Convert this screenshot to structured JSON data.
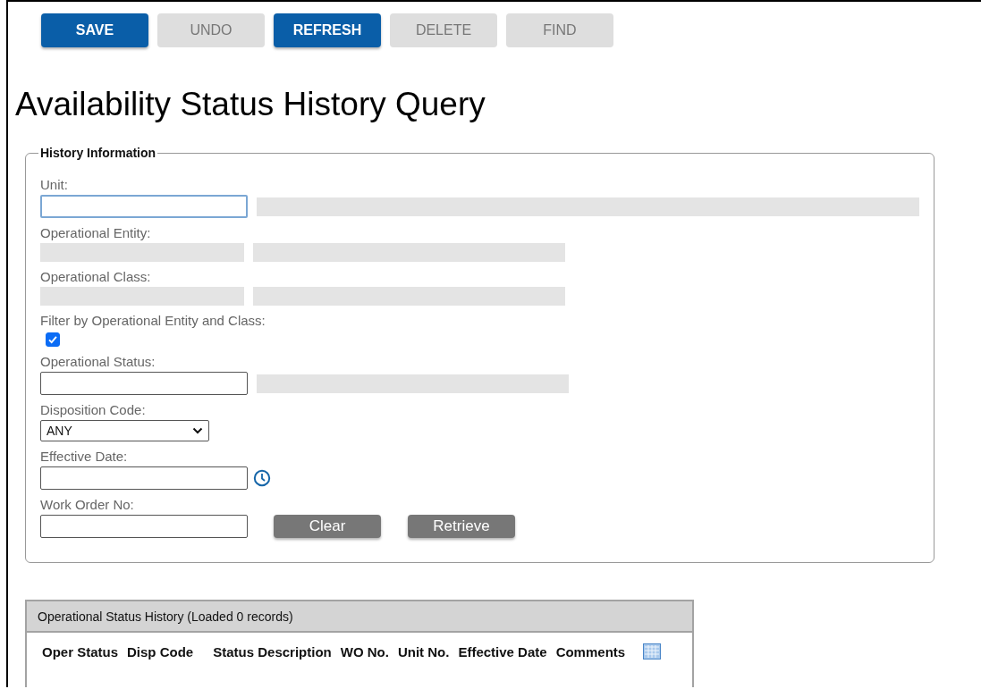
{
  "toolbar": [
    {
      "label": "SAVE",
      "disabled": false
    },
    {
      "label": "UNDO",
      "disabled": true
    },
    {
      "label": "REFRESH",
      "disabled": false
    },
    {
      "label": "DELETE",
      "disabled": true
    },
    {
      "label": "FIND",
      "disabled": true
    }
  ],
  "title": "Availability Status History Query",
  "history_information": {
    "legend": "History Information",
    "fields": [
      {
        "label": "Unit:",
        "kind": "input",
        "focused": true,
        "description": true,
        "wide": true
      },
      {
        "label": "Operational Entity:",
        "kind": "readonly",
        "description": true,
        "wide": false
      },
      {
        "label": "Operational Class:",
        "kind": "readonly",
        "description": true,
        "wide": false
      },
      {
        "label": "Filter by Operational Entity and Class:",
        "kind": "checkbox",
        "checked": true
      },
      {
        "label": "Operational Status:",
        "kind": "input",
        "focused": false,
        "description": true,
        "wide": false
      },
      {
        "label": "Disposition Code:",
        "kind": "select",
        "value": "ANY"
      },
      {
        "label": "Effective Date:",
        "kind": "date",
        "focused": false
      },
      {
        "label": "Work Order No:",
        "kind": "actions",
        "focused": false,
        "buttons": [
          "Clear",
          "Retrieve"
        ]
      }
    ]
  },
  "history_table": {
    "title": "Operational Status History (Loaded 0 records)",
    "columns": [
      "Oper Status",
      "Disp Code",
      "Status Description",
      "WO No.",
      "Unit No.",
      "Effective Date",
      "Comments"
    ]
  }
}
